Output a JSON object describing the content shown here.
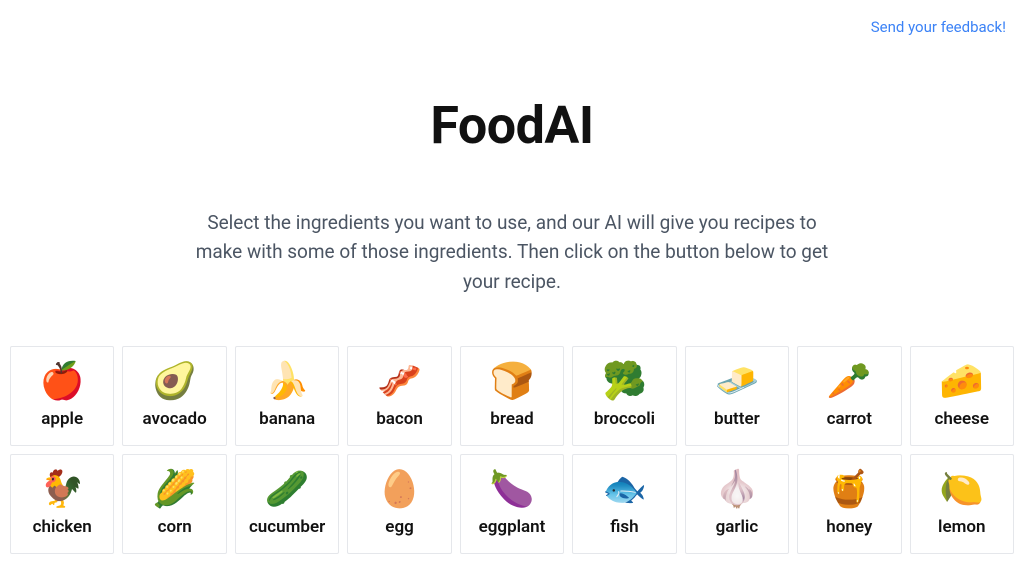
{
  "header": {
    "feedback_link": "Send your feedback!"
  },
  "main": {
    "title": "FoodAI",
    "description": "Select the ingredients you want to use, and our AI will give you recipes to make with some of those ingredients. Then click on the button below to get your recipe."
  },
  "ingredients": [
    {
      "emoji": "🍎",
      "label": "apple"
    },
    {
      "emoji": "🥑",
      "label": "avocado"
    },
    {
      "emoji": "🍌",
      "label": "banana"
    },
    {
      "emoji": "🥓",
      "label": "bacon"
    },
    {
      "emoji": "🍞",
      "label": "bread"
    },
    {
      "emoji": "🥦",
      "label": "broccoli"
    },
    {
      "emoji": "🧈",
      "label": "butter"
    },
    {
      "emoji": "🥕",
      "label": "carrot"
    },
    {
      "emoji": "🧀",
      "label": "cheese"
    },
    {
      "emoji": "🐓",
      "label": "chicken"
    },
    {
      "emoji": "🌽",
      "label": "corn"
    },
    {
      "emoji": "🥒",
      "label": "cucumber"
    },
    {
      "emoji": "🥚",
      "label": "egg"
    },
    {
      "emoji": "🍆",
      "label": "eggplant"
    },
    {
      "emoji": "🐟",
      "label": "fish"
    },
    {
      "emoji": "🧄",
      "label": "garlic"
    },
    {
      "emoji": "🍯",
      "label": "honey"
    },
    {
      "emoji": "🍋",
      "label": "lemon"
    }
  ]
}
